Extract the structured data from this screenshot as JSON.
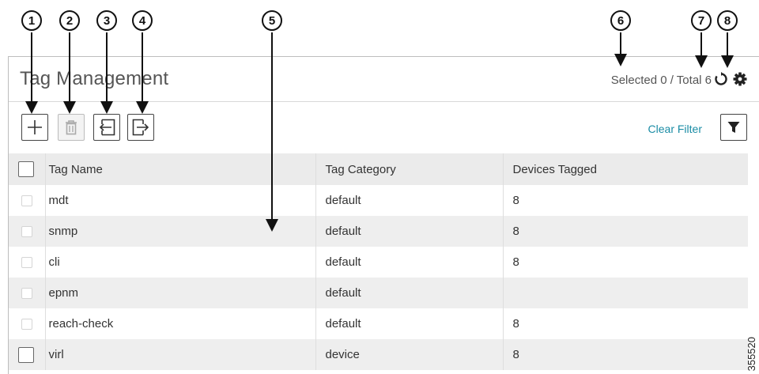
{
  "callouts": [
    "1",
    "2",
    "3",
    "4",
    "5",
    "6",
    "7",
    "8"
  ],
  "panel": {
    "title": "Tag Management",
    "selected_total": "Selected 0 / Total 6",
    "clear_filter": "Clear Filter"
  },
  "table": {
    "columns": [
      "Tag Name",
      "Tag Category",
      "Devices Tagged"
    ],
    "rows": [
      {
        "name": "mdt",
        "category": "default",
        "devices": "8"
      },
      {
        "name": "snmp",
        "category": "default",
        "devices": "8"
      },
      {
        "name": "cli",
        "category": "default",
        "devices": "8"
      },
      {
        "name": "epnm",
        "category": "default",
        "devices": ""
      },
      {
        "name": "reach-check",
        "category": "default",
        "devices": "8"
      },
      {
        "name": "virl",
        "category": "device",
        "devices": "8"
      }
    ]
  },
  "watermark": "355520",
  "icons": {
    "add": "plus-icon",
    "delete": "trash-icon",
    "import": "import-icon",
    "export": "export-icon",
    "refresh": "refresh-icon",
    "settings": "gear-icon",
    "filter": "filter-icon"
  },
  "colors": {
    "link": "#1a8ca5",
    "header_bg": "#ebebeb",
    "stripe_bg": "#eeeeee"
  }
}
